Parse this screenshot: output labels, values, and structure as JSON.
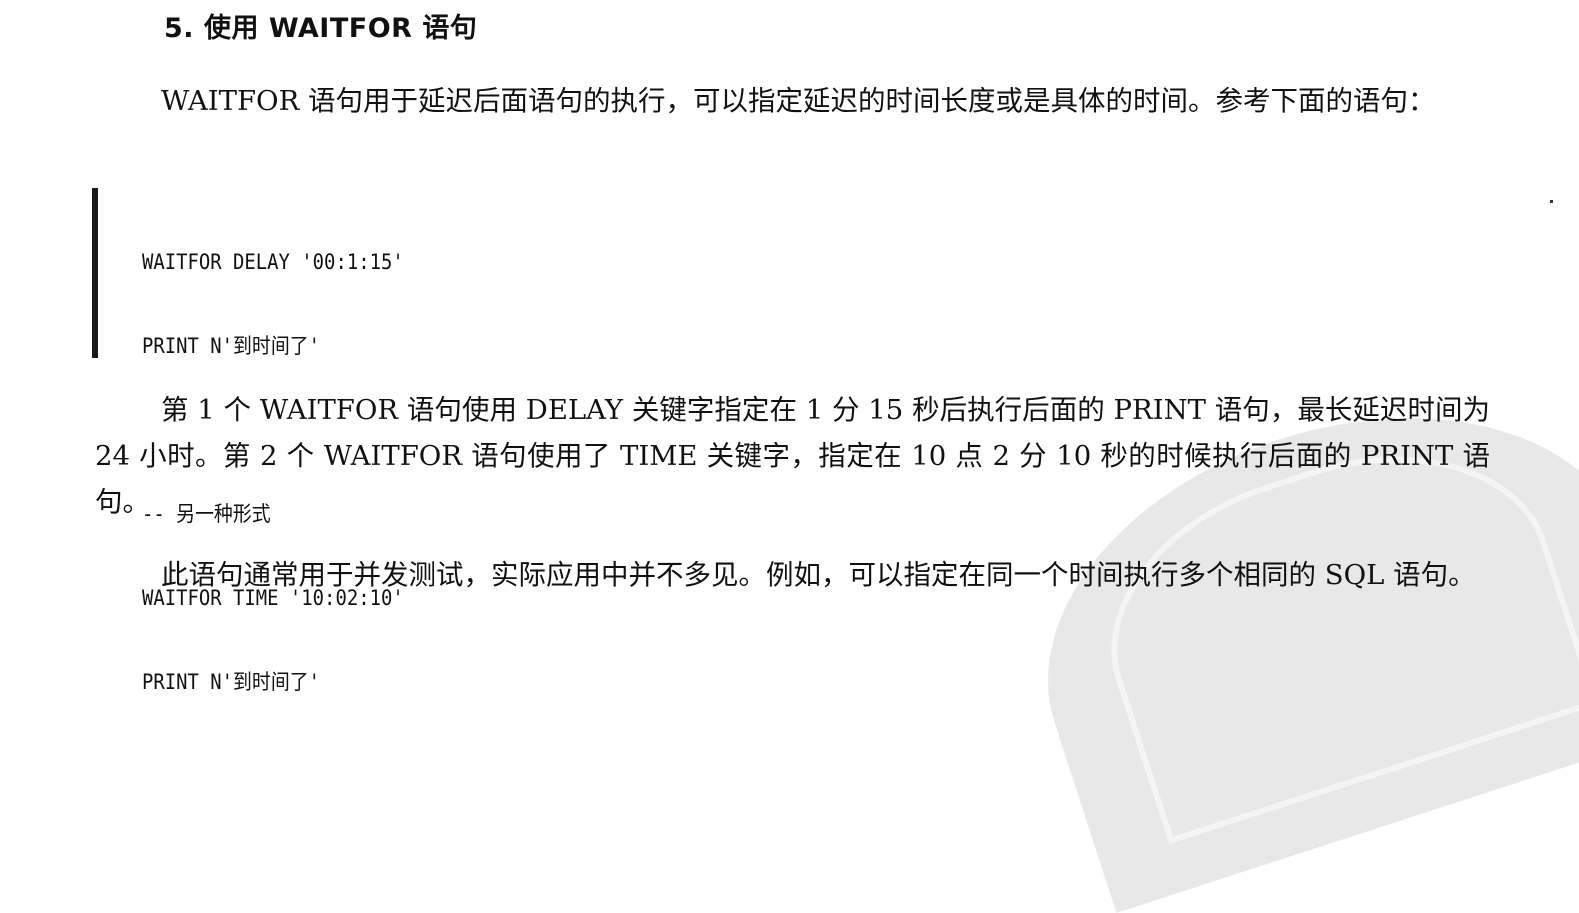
{
  "section": {
    "heading": "5.  使用 WAITFOR 语句"
  },
  "paragraphs": [
    "WAITFOR 语句用于延迟后面语句的执行，可以指定延迟的时间长度或是具体的时间。参考下面的语句：",
    "第 1 个 WAITFOR 语句使用 DELAY 关键字指定在 1 分 15 秒后执行后面的 PRINT 语句，最长延迟时间为 24 小时。第 2 个 WAITFOR 语句使用了 TIME 关键字，指定在 10 点 2 分 10 秒的时候执行后面的 PRINT 语句。",
    "此语句通常用于并发测试，实际应用中并不多见。例如，可以指定在同一个时间执行多个相同的 SQL 语句。"
  ],
  "code": {
    "lines": [
      "WAITFOR DELAY '00:1:15'",
      "PRINT N'到时间了'",
      "",
      "-- 另一种形式",
      "WAITFOR TIME '10:02:10'",
      "PRINT N'到时间了'"
    ]
  }
}
